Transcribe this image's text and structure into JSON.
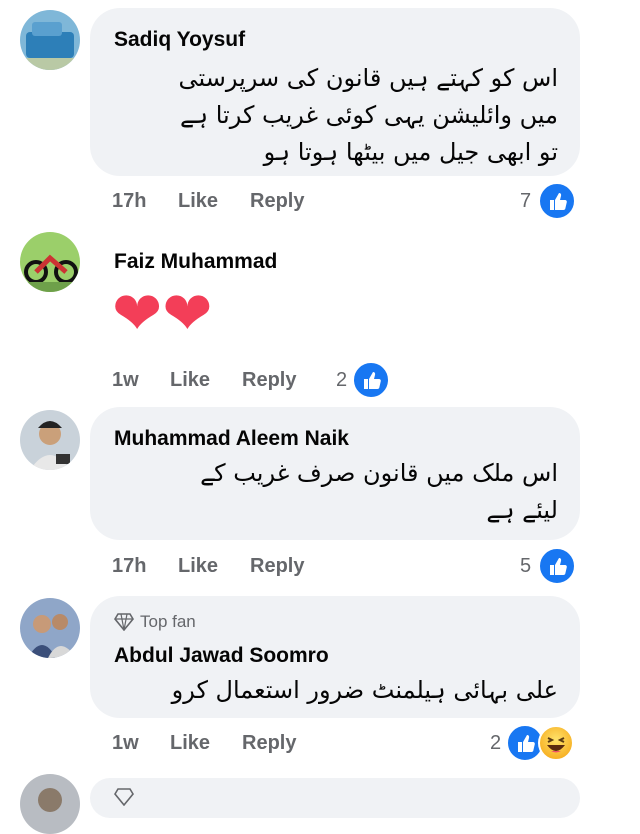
{
  "comments": [
    {
      "author": "Sadiq Yoysuf",
      "text": "اس کو کہتے ہیں قانون کی سرپرستی\nمیں وائلیشن یہی کوئی غریب کرتا ہے\nتو ابھی جیل میں بیٹھا ہوتا ہو",
      "time": "17h",
      "like": "Like",
      "reply": "Reply",
      "reactions": "7",
      "reaction_icons": [
        "like-icon"
      ]
    },
    {
      "author": "Faiz Muhammad",
      "emoji": "❤❤",
      "time": "1w",
      "like": "Like",
      "reply": "Reply",
      "reactions": "2",
      "reaction_icons": [
        "like-icon"
      ]
    },
    {
      "author": "Muhammad Aleem Naik",
      "text": "اس ملک میں قانون صرف غریب کے\nلیئے ہے",
      "time": "17h",
      "like": "Like",
      "reply": "Reply",
      "reactions": "5",
      "reaction_icons": [
        "like-icon"
      ]
    },
    {
      "author": "Abdul Jawad Soomro",
      "badge": "Top fan",
      "text": "علی بہائی ہیلمنٹ ضرور استعمال کرو",
      "time": "1w",
      "like": "Like",
      "reply": "Reply",
      "reactions": "2",
      "reaction_icons": [
        "like-icon",
        "haha-icon"
      ]
    }
  ],
  "colors": {
    "bubble": "#f0f2f5",
    "meta": "#65676b",
    "like_blue": "#1877f2",
    "heart": "#f33e58"
  }
}
